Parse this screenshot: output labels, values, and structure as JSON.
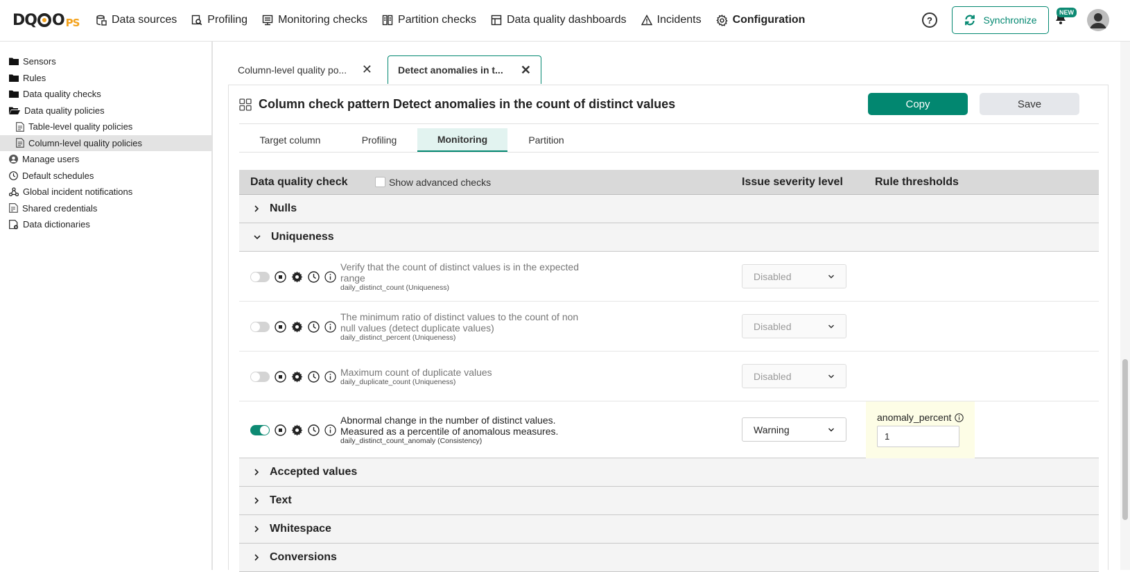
{
  "header": {
    "logo": {
      "d": "D",
      "q": "Q",
      "o": "O",
      "ps": "PS"
    },
    "nav": [
      {
        "label": "Data sources",
        "icon": "data-sources-icon"
      },
      {
        "label": "Profiling",
        "icon": "profiling-icon"
      },
      {
        "label": "Monitoring checks",
        "icon": "monitoring-icon"
      },
      {
        "label": "Partition checks",
        "icon": "partition-icon"
      },
      {
        "label": "Data quality dashboards",
        "icon": "dashboard-icon"
      },
      {
        "label": "Incidents",
        "icon": "warning-icon"
      },
      {
        "label": "Configuration",
        "icon": "gear-icon"
      }
    ],
    "help": "?",
    "sync_label": "Synchronize",
    "new_badge": "NEW"
  },
  "sidebar": {
    "items": [
      {
        "label": "Sensors",
        "icon": "folder-icon"
      },
      {
        "label": "Rules",
        "icon": "folder-icon"
      },
      {
        "label": "Data quality checks",
        "icon": "folder-icon"
      },
      {
        "label": "Data quality policies",
        "icon": "folder-open-icon"
      },
      {
        "label": "Table-level quality policies",
        "icon": "policy-file-icon"
      },
      {
        "label": "Column-level quality policies",
        "icon": "policy-file-icon"
      },
      {
        "label": "Manage users",
        "icon": "user-icon"
      },
      {
        "label": "Default schedules",
        "icon": "clock-icon"
      },
      {
        "label": "Global incident notifications",
        "icon": "webhook-icon"
      },
      {
        "label": "Shared credentials",
        "icon": "credentials-icon"
      },
      {
        "label": "Data dictionaries",
        "icon": "dictionary-icon"
      }
    ]
  },
  "tabs": [
    {
      "label": "Column-level quality po..."
    },
    {
      "label": "Detect anomalies in t..."
    }
  ],
  "panel": {
    "title": "Column check pattern Detect anomalies in the count of distinct values",
    "copy_label": "Copy",
    "save_label": "Save",
    "subtabs": [
      "Target column",
      "Profiling",
      "Monitoring",
      "Partition"
    ],
    "table": {
      "col_check": "Data quality check",
      "show_advanced": "Show advanced checks",
      "col_severity": "Issue severity level",
      "col_thresholds": "Rule thresholds",
      "groups": [
        "Nulls",
        "Uniqueness",
        "Accepted values",
        "Text",
        "Whitespace",
        "Conversions"
      ],
      "checks": [
        {
          "description": "Verify that the count of distinct values is in the expected range",
          "code": "daily_distinct_count (Uniqueness)",
          "severity": "Disabled",
          "enabled": false
        },
        {
          "description": "The minimum ratio of distinct values to the count of non null values (detect duplicate values)",
          "code": "daily_distinct_percent (Uniqueness)",
          "severity": "Disabled",
          "enabled": false
        },
        {
          "description": "Maximum count of duplicate values",
          "code": "daily_duplicate_count (Uniqueness)",
          "severity": "Disabled",
          "enabled": false
        },
        {
          "description": "Abnormal change in the number of distinct values. Measured as a percentile of anomalous measures.",
          "code": "daily_distinct_count_anomaly (Consistency)",
          "severity": "Warning",
          "enabled": true,
          "threshold_label": "anomaly_percent",
          "threshold_value": "1"
        }
      ]
    }
  },
  "colors": {
    "accent": "#028770",
    "highlight": "#fdfde6"
  }
}
